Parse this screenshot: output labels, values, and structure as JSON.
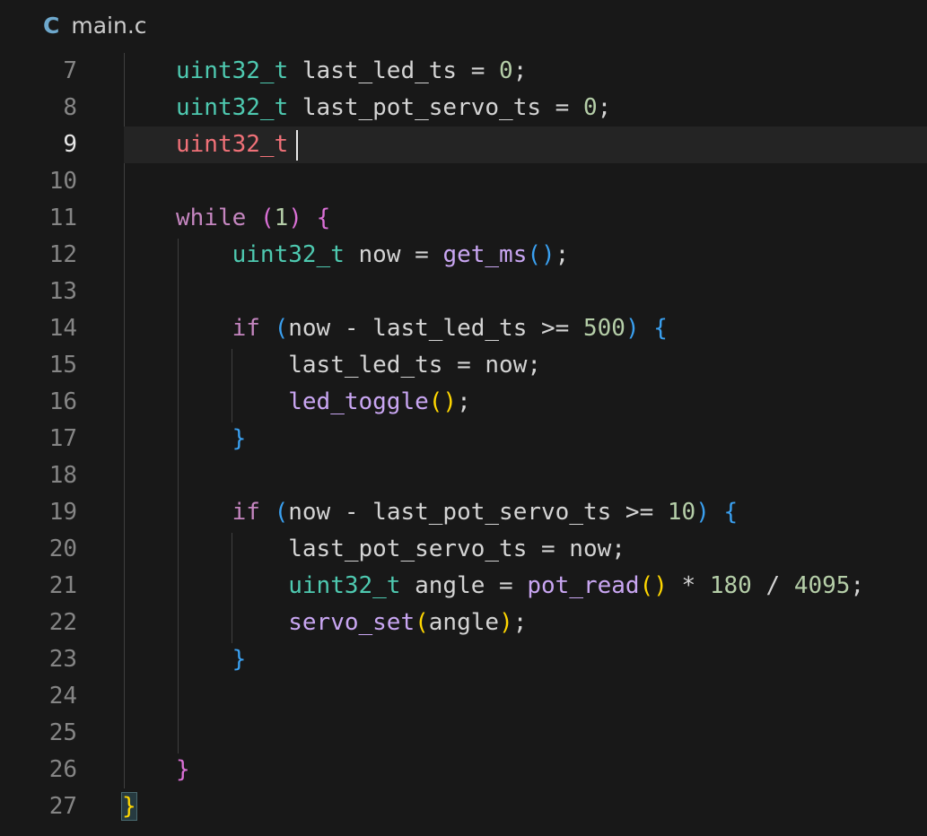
{
  "tab": {
    "language_icon": "C",
    "filename": "main.c"
  },
  "lines": [
    {
      "num": "7",
      "indent": "",
      "tokens": [
        {
          "t": "uint32_t",
          "c": "ty"
        },
        {
          "t": " last_led_ts = "
        },
        {
          "t": "0",
          "c": "num"
        },
        {
          "t": ";"
        }
      ]
    },
    {
      "num": "8",
      "indent": "",
      "tokens": [
        {
          "t": "uint32_t",
          "c": "ty"
        },
        {
          "t": " last_pot_servo_ts = "
        },
        {
          "t": "0",
          "c": "num"
        },
        {
          "t": ";"
        }
      ]
    },
    {
      "num": "9",
      "indent": "",
      "current": true,
      "tokens": [
        {
          "t": "uint32_t",
          "c": "ty-err"
        },
        {
          "t": " "
        }
      ]
    },
    {
      "num": "10",
      "indent": "",
      "tokens": []
    },
    {
      "num": "11",
      "indent": "",
      "tokens": [
        {
          "t": "while",
          "c": "kw"
        },
        {
          "t": " "
        },
        {
          "t": "(",
          "c": "b1"
        },
        {
          "t": "1",
          "c": "num"
        },
        {
          "t": ")",
          "c": "b1"
        },
        {
          "t": " "
        },
        {
          "t": "{",
          "c": "b1"
        }
      ]
    },
    {
      "num": "12",
      "indent": "    ",
      "tokens": [
        {
          "t": "uint32_t",
          "c": "ty"
        },
        {
          "t": " now = "
        },
        {
          "t": "get_ms",
          "c": "fn"
        },
        {
          "t": "()",
          "c": "b2"
        },
        {
          "t": ";"
        }
      ]
    },
    {
      "num": "13",
      "indent": "",
      "tokens": []
    },
    {
      "num": "14",
      "indent": "    ",
      "tokens": [
        {
          "t": "if",
          "c": "kw"
        },
        {
          "t": " "
        },
        {
          "t": "(",
          "c": "b2"
        },
        {
          "t": "now - last_led_ts >= "
        },
        {
          "t": "500",
          "c": "num"
        },
        {
          "t": ")",
          "c": "b2"
        },
        {
          "t": " "
        },
        {
          "t": "{",
          "c": "b2"
        }
      ]
    },
    {
      "num": "15",
      "indent": "        ",
      "tokens": [
        {
          "t": "last_led_ts = now;"
        }
      ]
    },
    {
      "num": "16",
      "indent": "        ",
      "tokens": [
        {
          "t": "led_toggle",
          "c": "fn"
        },
        {
          "t": "()",
          "c": "b3"
        },
        {
          "t": ";"
        }
      ]
    },
    {
      "num": "17",
      "indent": "    ",
      "tokens": [
        {
          "t": "}",
          "c": "b2"
        }
      ]
    },
    {
      "num": "18",
      "indent": "",
      "tokens": []
    },
    {
      "num": "19",
      "indent": "    ",
      "tokens": [
        {
          "t": "if",
          "c": "kw"
        },
        {
          "t": " "
        },
        {
          "t": "(",
          "c": "b2"
        },
        {
          "t": "now - last_pot_servo_ts >= "
        },
        {
          "t": "10",
          "c": "num"
        },
        {
          "t": ")",
          "c": "b2"
        },
        {
          "t": " "
        },
        {
          "t": "{",
          "c": "b2"
        }
      ]
    },
    {
      "num": "20",
      "indent": "        ",
      "tokens": [
        {
          "t": "last_pot_servo_ts = now;"
        }
      ]
    },
    {
      "num": "21",
      "indent": "        ",
      "tokens": [
        {
          "t": "uint32_t",
          "c": "ty"
        },
        {
          "t": " angle = "
        },
        {
          "t": "pot_read",
          "c": "fn"
        },
        {
          "t": "()",
          "c": "b3"
        },
        {
          "t": " * "
        },
        {
          "t": "180",
          "c": "num"
        },
        {
          "t": " / "
        },
        {
          "t": "4095",
          "c": "num"
        },
        {
          "t": ";"
        }
      ]
    },
    {
      "num": "22",
      "indent": "        ",
      "tokens": [
        {
          "t": "servo_set",
          "c": "fn"
        },
        {
          "t": "(",
          "c": "b3"
        },
        {
          "t": "angle"
        },
        {
          "t": ")",
          "c": "b3"
        },
        {
          "t": ";"
        }
      ]
    },
    {
      "num": "23",
      "indent": "    ",
      "tokens": [
        {
          "t": "}",
          "c": "b2"
        }
      ]
    },
    {
      "num": "24",
      "indent": "",
      "tokens": []
    },
    {
      "num": "25",
      "indent": "",
      "tokens": []
    },
    {
      "num": "26",
      "indent": "",
      "tokens": [
        {
          "t": "}",
          "c": "b1"
        }
      ]
    },
    {
      "num": "27",
      "indent": "",
      "outer": true,
      "tokens": [
        {
          "t": "}",
          "c": "bm"
        }
      ]
    }
  ],
  "colors": {
    "background": "#181818",
    "type": "#4ec9b0",
    "keyword": "#c586c0",
    "function": "#c9a6f2",
    "number": "#b5cea8",
    "bracket_level1": "#da70d6",
    "bracket_level2": "#3aa0f0",
    "bracket_level3": "#ffd700"
  }
}
